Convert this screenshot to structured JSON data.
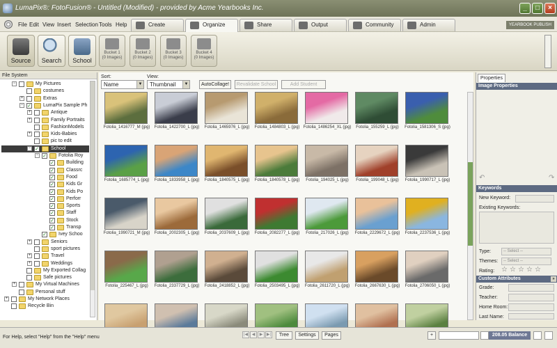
{
  "window": {
    "title": "LumaPix®: FotoFusion® - Untitled (Modified) - provided by Acme Yearbooks Inc."
  },
  "menu": [
    "File",
    "Edit",
    "View",
    "Insert",
    "Selection",
    "Tools",
    "Help"
  ],
  "tabs": [
    {
      "label": "Create",
      "icon": "pencil-icon"
    },
    {
      "label": "Organize",
      "icon": "magnifier-icon",
      "active": true
    },
    {
      "label": "Share",
      "icon": "share-icon"
    },
    {
      "label": "Output",
      "icon": "printer-icon"
    },
    {
      "label": "Community",
      "icon": "people-icon"
    },
    {
      "label": "Admin",
      "icon": "admin-icon"
    }
  ],
  "brand": "YEARBOOK PUBLISH",
  "toolbar": {
    "buttons": [
      {
        "label": "Source",
        "icon": "phone-icon",
        "active": true
      },
      {
        "label": "Search",
        "icon": "search-icon"
      },
      {
        "label": "School",
        "icon": "school-icon"
      }
    ],
    "buckets": [
      {
        "name": "Bucket 1",
        "count": "(0 Images)"
      },
      {
        "name": "Bucket 2",
        "count": "(0 Images)"
      },
      {
        "name": "Bucket 3",
        "count": "(0 Images)"
      },
      {
        "name": "Bucket 4",
        "count": "(0 Images)"
      }
    ]
  },
  "left_panel": {
    "title": "File System",
    "tree": [
      {
        "label": "My Pictures",
        "level": 1,
        "exp": "-",
        "check": ""
      },
      {
        "label": "costumes",
        "level": 2,
        "exp": "",
        "check": ""
      },
      {
        "label": "Extras",
        "level": 2,
        "exp": "+",
        "check": ""
      },
      {
        "label": "LumaPix Sample Ph",
        "level": 2,
        "exp": "-",
        "check": "✓"
      },
      {
        "label": "Antique",
        "level": 3,
        "exp": "+",
        "check": ""
      },
      {
        "label": "Family Portraits",
        "level": 3,
        "exp": "+",
        "check": ""
      },
      {
        "label": "FashionModels",
        "level": 3,
        "exp": "",
        "check": ""
      },
      {
        "label": "Kids-Babies",
        "level": 3,
        "exp": "+",
        "check": ""
      },
      {
        "label": "pic to edit",
        "level": 3,
        "exp": "",
        "check": ""
      },
      {
        "label": "School",
        "level": 3,
        "exp": "-",
        "check": "✓",
        "selected": true
      },
      {
        "label": "Fotolia Roy",
        "level": 4,
        "exp": "-",
        "check": "✓"
      },
      {
        "label": "Building",
        "level": 5,
        "exp": "",
        "check": "✓"
      },
      {
        "label": "Classrc",
        "level": 5,
        "exp": "",
        "check": "✓"
      },
      {
        "label": "Food",
        "level": 5,
        "exp": "",
        "check": "✓"
      },
      {
        "label": "Kids Gr",
        "level": 5,
        "exp": "",
        "check": "✓"
      },
      {
        "label": "Kids Po",
        "level": 5,
        "exp": "",
        "check": "✓"
      },
      {
        "label": "Perforr",
        "level": 5,
        "exp": "",
        "check": "✓"
      },
      {
        "label": "Sports",
        "level": 5,
        "exp": "",
        "check": "✓"
      },
      {
        "label": "Staff",
        "level": 5,
        "exp": "",
        "check": "✓"
      },
      {
        "label": "Stock",
        "level": 5,
        "exp": "",
        "check": "✓"
      },
      {
        "label": "Transp",
        "level": 5,
        "exp": "",
        "check": "✓"
      },
      {
        "label": "Ivey Schoo",
        "level": 4,
        "exp": "",
        "check": "✓"
      },
      {
        "label": "Seniors",
        "level": 3,
        "exp": "+",
        "check": ""
      },
      {
        "label": "sport pictures",
        "level": 3,
        "exp": "",
        "check": ""
      },
      {
        "label": "Travel",
        "level": 3,
        "exp": "+",
        "check": ""
      },
      {
        "label": "Weddings",
        "level": 3,
        "exp": "+",
        "check": ""
      },
      {
        "label": "My Exported Collag",
        "level": 2,
        "exp": "",
        "check": ""
      },
      {
        "label": "Safe pictures",
        "level": 2,
        "exp": "",
        "check": ""
      },
      {
        "label": "My Virtual Machines",
        "level": 1,
        "exp": "+",
        "check": ""
      },
      {
        "label": "Personal stuff",
        "level": 1,
        "exp": "",
        "check": ""
      },
      {
        "label": "My Network Places",
        "level": 0,
        "exp": "+",
        "check": ""
      },
      {
        "label": "Recycle Bin",
        "level": 0,
        "exp": "",
        "check": ""
      }
    ]
  },
  "controls": {
    "sort_label": "Sort:",
    "sort_value": "Name",
    "view_label": "View:",
    "view_value": "Thumbnail",
    "autocollage": "AutoCollage!",
    "revalidate": "Revalidate School",
    "add_student": "Add Student"
  },
  "thumbnails": [
    {
      "name": "Fotolia_1416777_M (jpg)",
      "c1": "#5c6e3e",
      "c2": "#d9c27a"
    },
    {
      "name": "Fotolia_1422700_L (jpg)",
      "c1": "#3a3d4a",
      "c2": "#c9cdd6"
    },
    {
      "name": "Fotolia_1465976_L (jpg)",
      "c1": "#e9e4d7",
      "c2": "#b79a70"
    },
    {
      "name": "Fotolia_1484803_L (jpg)",
      "c1": "#8a6b3a",
      "c2": "#d0b06a"
    },
    {
      "name": "Fotolia_1486254_XL (jpg)",
      "c1": "#f0eaea",
      "c2": "#e46aa4"
    },
    {
      "name": "Fotolia_155259_L (jpg)",
      "c1": "#2f4d35",
      "c2": "#5f8a63"
    },
    {
      "name": "Fotolia_1581306_S (jpg)",
      "c1": "#4f8c3c",
      "c2": "#3a5fae"
    },
    {
      "name": "Fotolia_1685774_L (jpg)",
      "c1": "#5aa046",
      "c2": "#2d64b0"
    },
    {
      "name": "Fotolia_1833958_L (jpg)",
      "c1": "#3c87c8",
      "c2": "#d9a476"
    },
    {
      "name": "Fotolia_1840575_L (jpg)",
      "c1": "#7a4f2a",
      "c2": "#e0b670"
    },
    {
      "name": "Fotolia_1840578_L (jpg)",
      "c1": "#4b7b3a",
      "c2": "#e7c48e"
    },
    {
      "name": "Fotolia_194025_L (jpg)",
      "c1": "#7d7166",
      "c2": "#c8b9a7"
    },
    {
      "name": "Fotolia_199048_L (jpg)",
      "c1": "#a0402a",
      "c2": "#e6d3c0"
    },
    {
      "name": "Fotolia_1990717_L (jpg)",
      "c1": "#c9c2b6",
      "c2": "#3a3a3a"
    },
    {
      "name": "Fotolia_1990721_M (jpg)",
      "c1": "#d8d4c9",
      "c2": "#4a5a6a"
    },
    {
      "name": "Fotolia_2002305_L (jpg)",
      "c1": "#9c6a3a",
      "c2": "#e9c8a0"
    },
    {
      "name": "Fotolia_2037609_L (jpg)",
      "c1": "#3a6a3a",
      "c2": "#e0e0e0"
    },
    {
      "name": "Fotolia_2082277_L (jpg)",
      "c1": "#3e7a32",
      "c2": "#c03030"
    },
    {
      "name": "Fotolia_217026_L (jpg)",
      "c1": "#4c9a3a",
      "c2": "#dfe8f0"
    },
    {
      "name": "Fotolia_2229672_L (jpg)",
      "c1": "#6aa0d0",
      "c2": "#e9c19a"
    },
    {
      "name": "Fotolia_2237536_L (jpg)",
      "c1": "#8ab6e0",
      "c2": "#e0b020"
    },
    {
      "name": "Fotolia_225467_L (jpg)",
      "c1": "#58a84a",
      "c2": "#8a6a4a"
    },
    {
      "name": "Fotolia_2337729_L (jpg)",
      "c1": "#3c6d3c",
      "c2": "#b0a090"
    },
    {
      "name": "Fotolia_2418852_L (jpg)",
      "c1": "#5a4a3a",
      "c2": "#d0b090"
    },
    {
      "name": "Fotolia_2503495_L (jpg)",
      "c1": "#3c8a30",
      "c2": "#e0e0e0"
    },
    {
      "name": "Fotolia_2611720_L (jpg)",
      "c1": "#c0a070",
      "c2": "#e8e8e8"
    },
    {
      "name": "Fotolia_2667630_L (jpg)",
      "c1": "#6a4a2a",
      "c2": "#d8a060"
    },
    {
      "name": "Fotolia_2706050_L (jpg)",
      "c1": "#6a6a6a",
      "c2": "#e0d0c0"
    },
    {
      "name": "",
      "c1": "#c8a070",
      "c2": "#e0c8a0"
    },
    {
      "name": "",
      "c1": "#5a7a9a",
      "c2": "#d0c0b0"
    },
    {
      "name": "",
      "c1": "#8a8a7a",
      "c2": "#d8d8c8"
    },
    {
      "name": "",
      "c1": "#4c8a3c",
      "c2": "#a0c080"
    },
    {
      "name": "",
      "c1": "#7a9ab0",
      "c2": "#d0e0f0"
    },
    {
      "name": "",
      "c1": "#b07050",
      "c2": "#e0c0a0"
    },
    {
      "name": "",
      "c1": "#5a8040",
      "c2": "#c0d0a0"
    }
  ],
  "right_panel": {
    "tab": "Properties",
    "image_properties": "Image Properties",
    "keywords_head": "Keywords",
    "new_keyword": "New Keyword:",
    "existing_keywords": "Existing Keywords:",
    "type_label": "Type:",
    "type_value": "-- Select --",
    "themes_label": "Themes:",
    "themes_value": "-- Select --",
    "rating_label": "Rating:",
    "custom_head": "Custom Attributes",
    "grade": "Grade:",
    "teacher": "Teacher:",
    "homeroom": "Home Room:",
    "lastname": "Last Name:"
  },
  "statusbar": {
    "help": "For Help, select \"Help\" from the \"Help\" menu",
    "tree": "Tree",
    "settings": "Settings",
    "pages": "Pages",
    "plus": "+",
    "balance": "208.05 Balance"
  }
}
